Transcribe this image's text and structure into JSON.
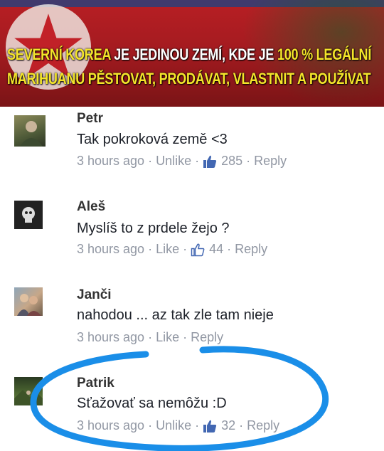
{
  "banner": {
    "part1_hl": "SEVERNÍ KOREA",
    "part2": " JE JEDINOU ZEMÍ, KDE JE ",
    "part3_hl": "100 % LEGÁLNÍ",
    "line2_hl": "MARIHUANU PĚSTOVAT, PRODÁVAT, VLASTNIT A POUŽÍVAT",
    "highlight_color": "#f4e52a"
  },
  "comments": [
    {
      "name": "Petr",
      "text": "Tak pokroková země <3",
      "time": "3 hours ago",
      "sep": "·",
      "action": "Unlike",
      "count": "285",
      "reply": "Reply"
    },
    {
      "name": "Aleš",
      "text": "Myslíš to z prdele žejo ?",
      "time": "3 hours ago",
      "sep": "·",
      "action": "Like",
      "count": "44",
      "reply": "Reply"
    },
    {
      "name": "Janči",
      "text": "nahodou ... az tak zle tam nieje",
      "time": "3 hours ago",
      "sep": "·",
      "action": "Like",
      "count": "",
      "reply": "Reply"
    },
    {
      "name": "Patrik",
      "text": "Sťažovať sa nemôžu :D",
      "time": "3 hours ago",
      "sep": "·",
      "action": "Unlike",
      "count": "32",
      "reply": "Reply"
    }
  ],
  "colors": {
    "like_blue": "#4267b2",
    "meta_gray": "#9197a3",
    "annotation_circle": "#1a8ee8"
  }
}
